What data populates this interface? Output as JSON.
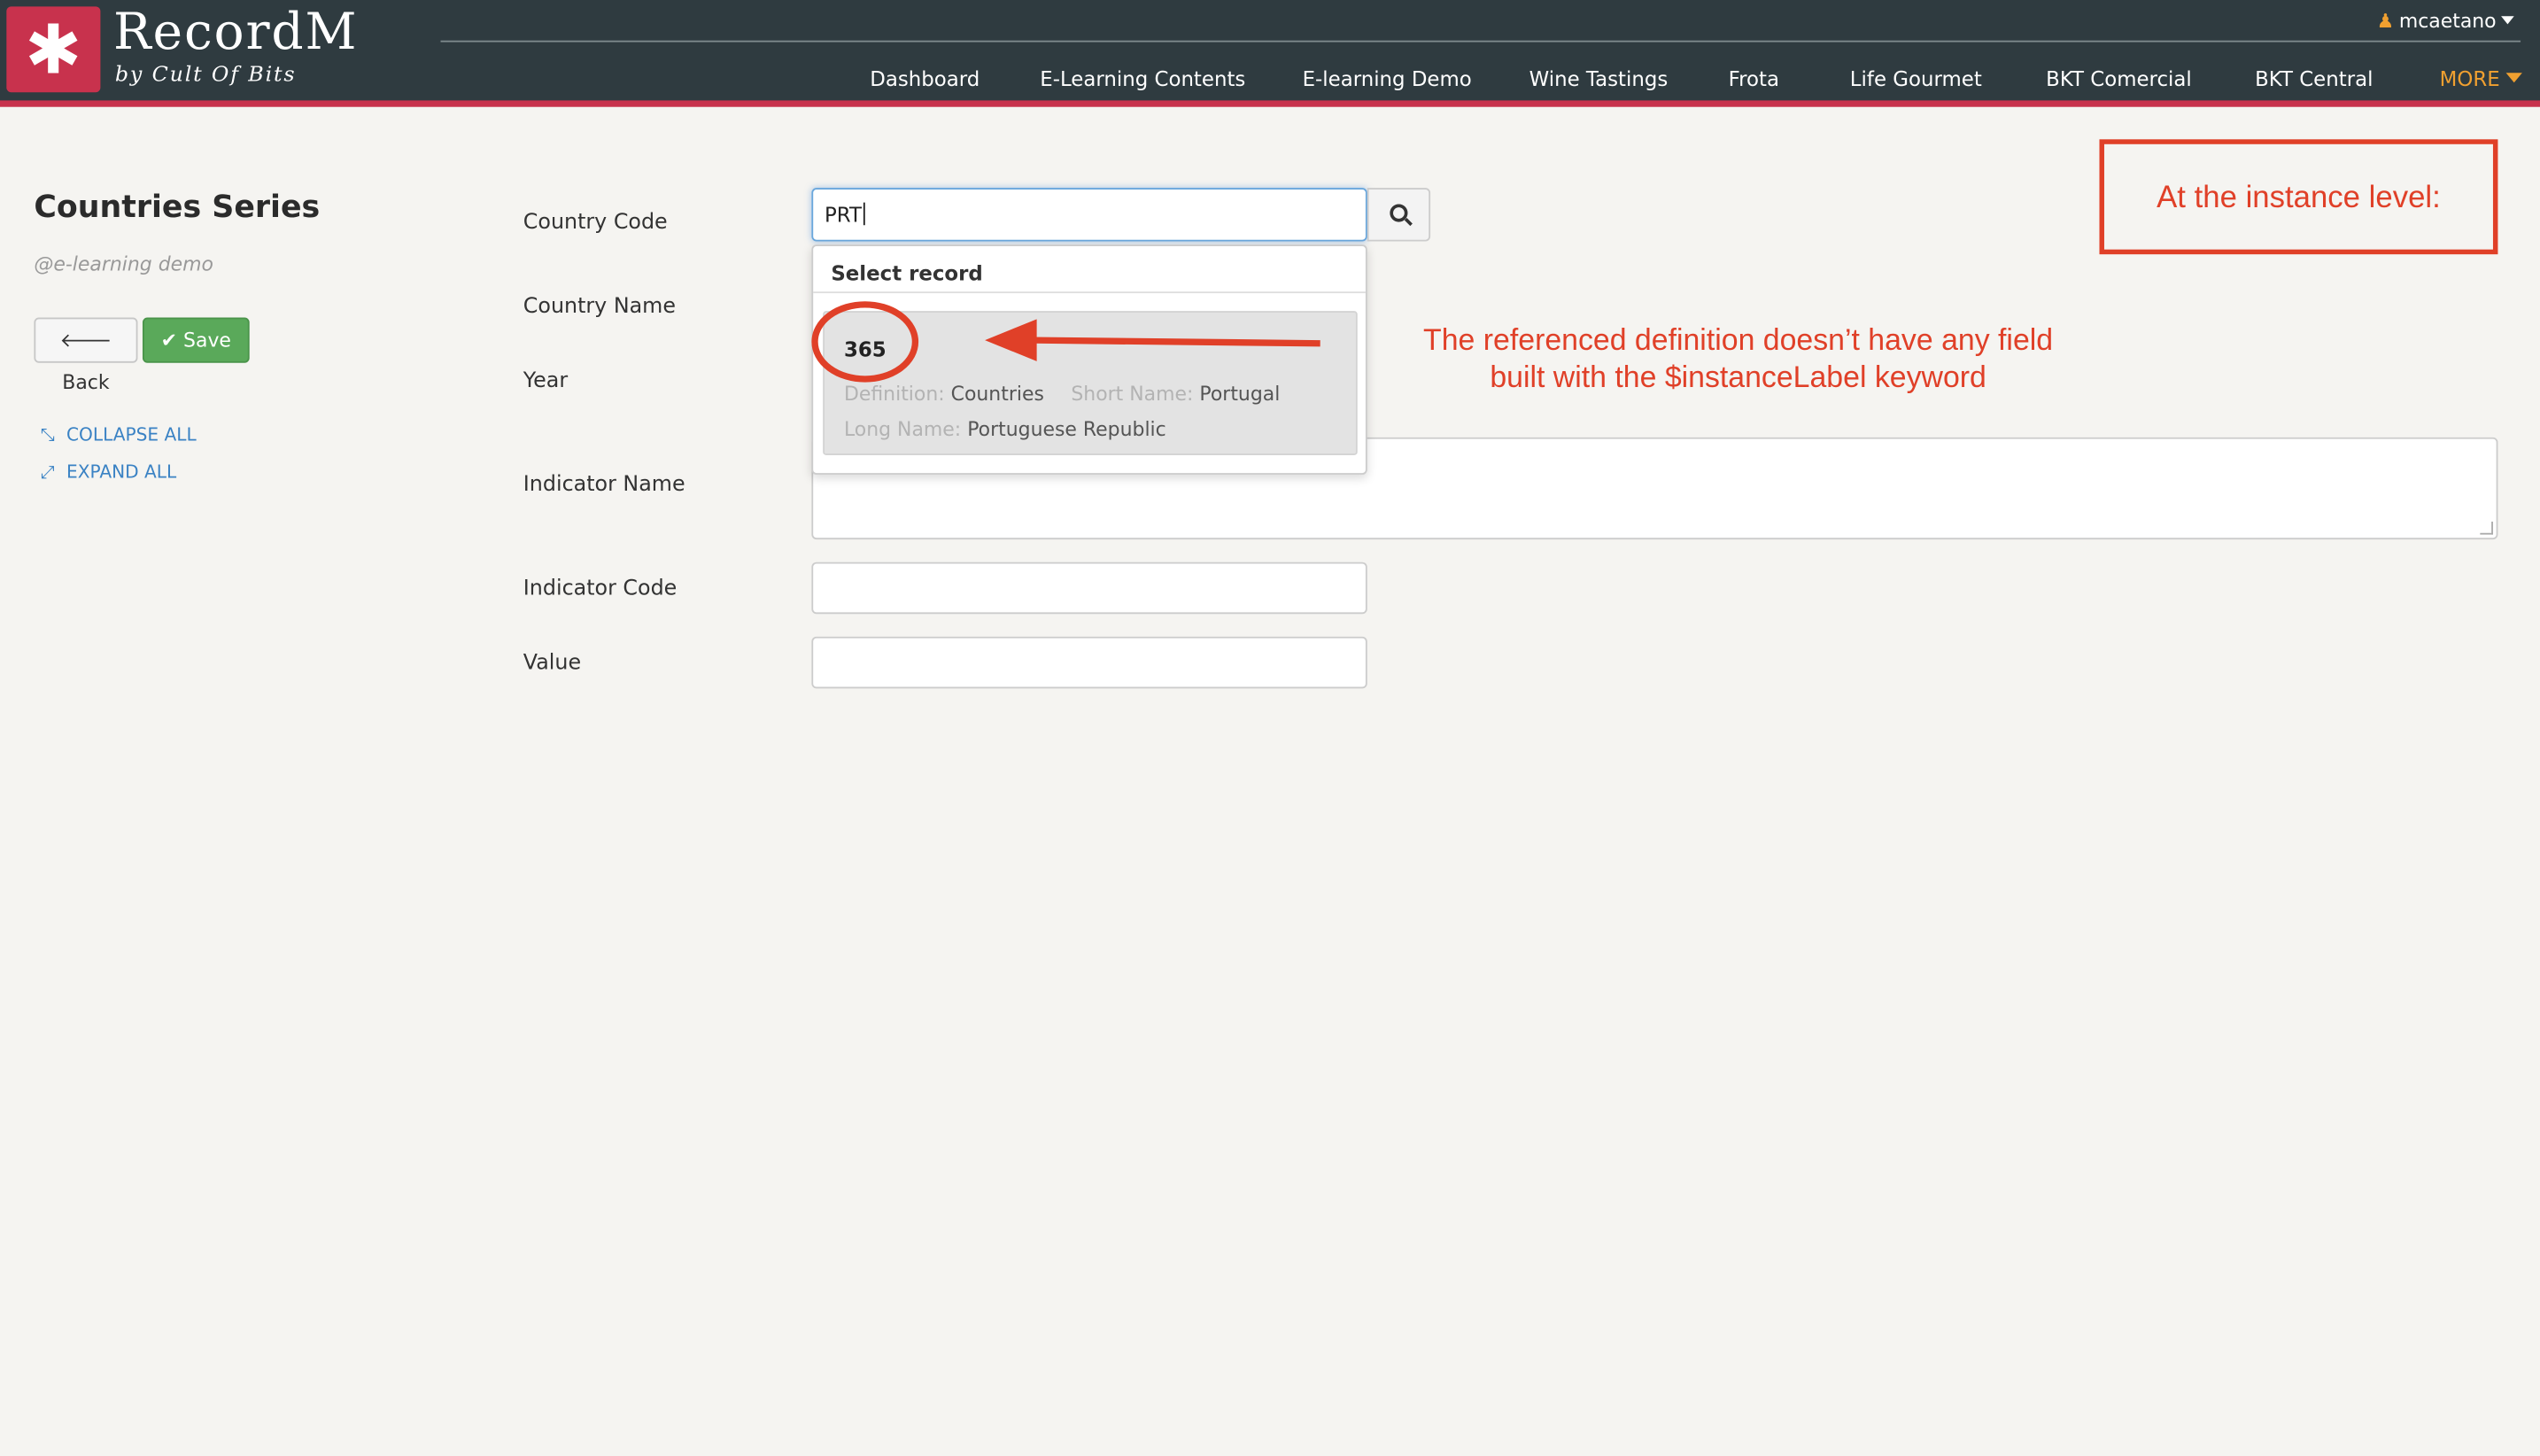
{
  "app": {
    "brand": "RecordM",
    "brand_sub": "by Cult Of Bits",
    "user": "mcaetano"
  },
  "nav": {
    "items": [
      "Dashboard",
      "E-Learning Contents",
      "E-learning Demo",
      "Wine Tastings",
      "Frota",
      "Life Gourmet",
      "BKT Comercial",
      "BKT Central"
    ],
    "more": "MORE"
  },
  "page": {
    "title": "Countries Series",
    "subtitle": "@e-learning demo"
  },
  "buttons": {
    "back": "Back",
    "save": "Save"
  },
  "sidebar": {
    "collapse": "COLLAPSE ALL",
    "expand": "EXPAND ALL"
  },
  "form": {
    "country_code_label": "Country Code",
    "country_code_value": "PRT",
    "country_name_label": "Country Name",
    "year_label": "Year",
    "indicator_name_label": "Indicator Name",
    "indicator_code_label": "Indicator Code",
    "value_label": "Value"
  },
  "dropdown": {
    "header": "Select record",
    "record": {
      "id": "365",
      "definition_key": "Definition:",
      "definition_value": "Countries",
      "short_name_key": "Short Name:",
      "short_name_value": "Portugal",
      "long_name_key": "Long Name:",
      "long_name_value": "Portuguese Republic"
    }
  },
  "annotations": {
    "box_text": "At the instance level:",
    "note_line1": "The referenced definition doesn’t have any field",
    "note_line2": "built with the $instanceLabel keyword",
    "color": "#e04028"
  },
  "colors": {
    "navbar": "#2f3b40",
    "brand_red": "#c8324d",
    "accent_orange": "#f0a030",
    "save_green": "#5aa95a",
    "link_blue": "#3a82c4"
  }
}
